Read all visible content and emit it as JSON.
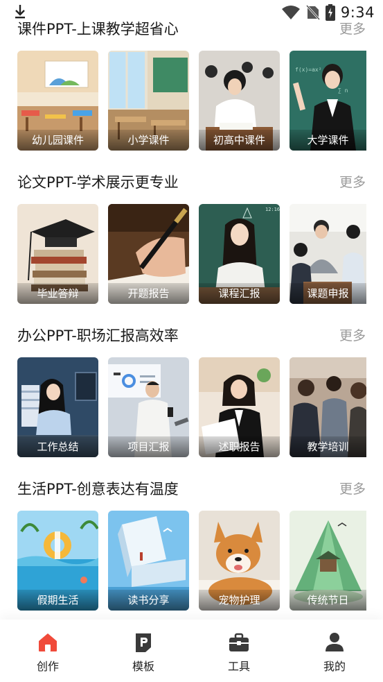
{
  "status_bar": {
    "time": "9:34"
  },
  "sections": [
    {
      "title": "课件PPT-上课教学超省心",
      "more": "更多",
      "cards": [
        {
          "label": "幼儿园课件"
        },
        {
          "label": "小学课件"
        },
        {
          "label": "初高中课件"
        },
        {
          "label": "大学课件"
        }
      ]
    },
    {
      "title": "论文PPT-学术展示更专业",
      "more": "更多",
      "cards": [
        {
          "label": "毕业答辩"
        },
        {
          "label": "开题报告"
        },
        {
          "label": "课程汇报"
        },
        {
          "label": "课题申报"
        }
      ]
    },
    {
      "title": "办公PPT-职场汇报高效率",
      "more": "更多",
      "cards": [
        {
          "label": "工作总结"
        },
        {
          "label": "项目汇报"
        },
        {
          "label": "述职报告"
        },
        {
          "label": "教学培训"
        }
      ]
    },
    {
      "title": "生活PPT-创意表达有温度",
      "more": "更多",
      "cards": [
        {
          "label": "假期生活"
        },
        {
          "label": "读书分享"
        },
        {
          "label": "宠物护理"
        },
        {
          "label": "传统节日"
        }
      ]
    }
  ],
  "tabbar": {
    "items": [
      {
        "label": "创作",
        "icon": "home-icon",
        "active": true
      },
      {
        "label": "模板",
        "icon": "template-icon",
        "active": false
      },
      {
        "label": "工具",
        "icon": "toolbox-icon",
        "active": false
      },
      {
        "label": "我的",
        "icon": "user-icon",
        "active": false
      }
    ],
    "active_color": "#f04a3a",
    "inactive_color": "#3a3a3a"
  }
}
